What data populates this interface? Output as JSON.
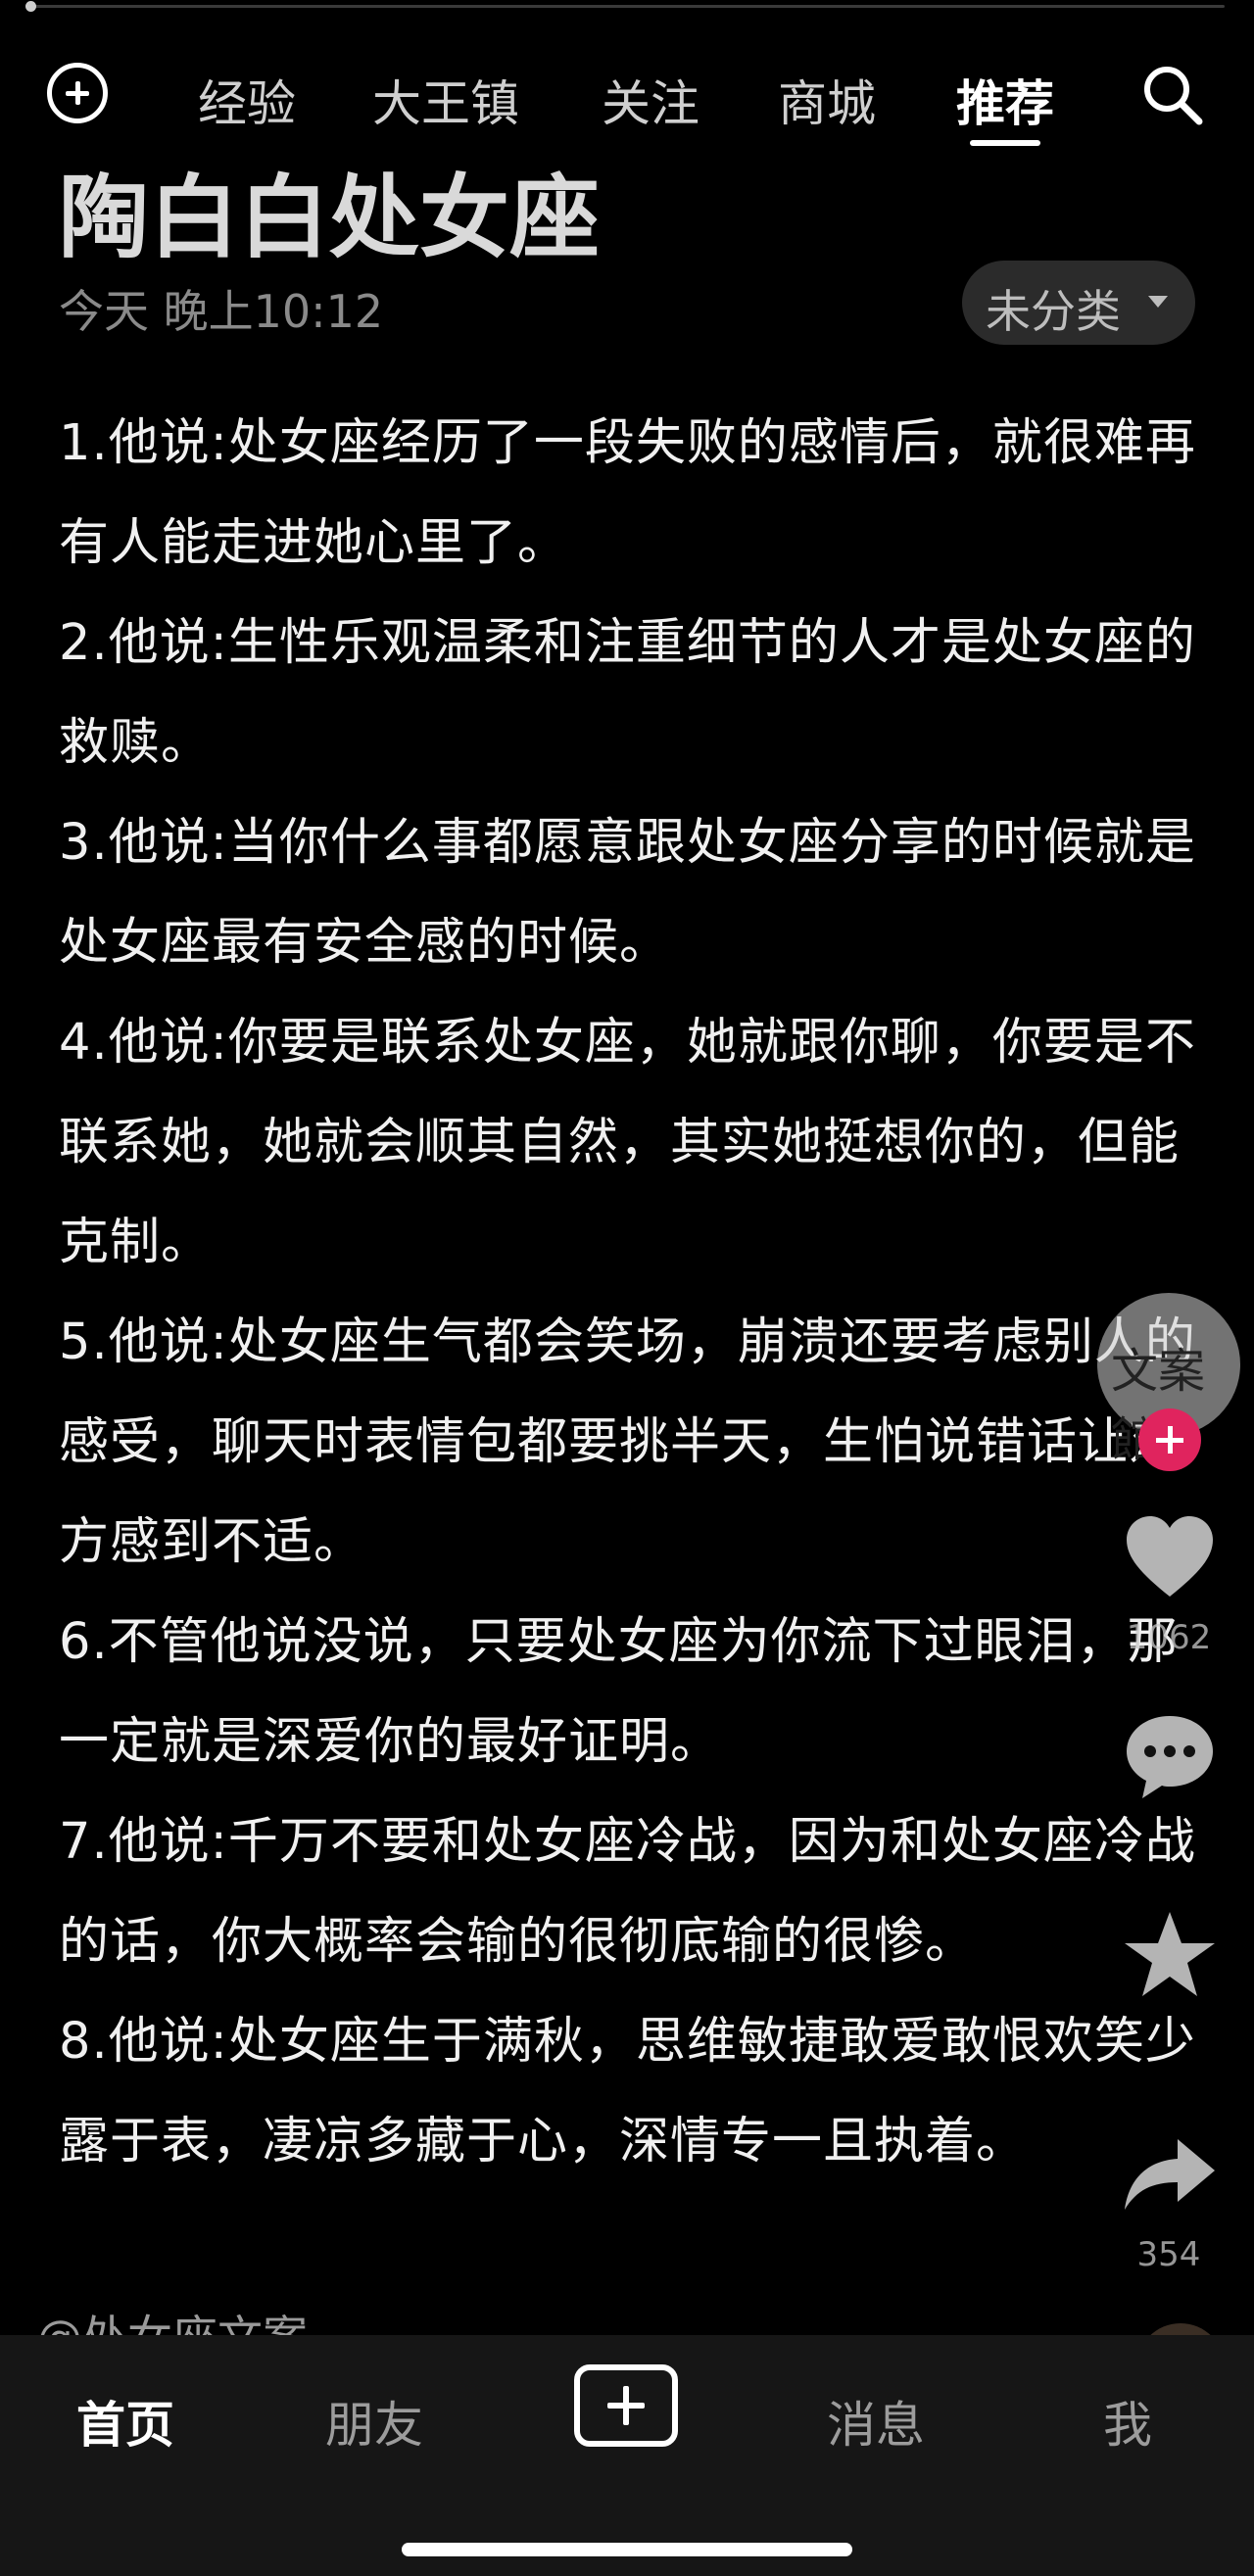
{
  "top_nav": {
    "tabs": [
      {
        "label": "经验",
        "active": false
      },
      {
        "label": "大王镇",
        "active": false
      },
      {
        "label": "关注",
        "active": false
      },
      {
        "label": "商城",
        "active": false
      },
      {
        "label": "推荐",
        "active": true
      }
    ]
  },
  "post": {
    "title": "陶白白处女座",
    "time": "今天 晚上10:12",
    "category": "未分类",
    "paragraphs": [
      "1.他说:处女座经历了一段失败的感情后，就很难再有人能走进她心里了。",
      "2.他说:生性乐观温柔和注重细节的人才是处女座的救赎。",
      "3.他说:当你什么事都愿意跟处女座分享的时候就是处女座最有安全感的时候。",
      "4.他说:你要是联系处女座，她就跟你聊，你要是不联系她，她就会顺其自然，其实她挺想你的，但能克制。",
      "5.他说:处女座生气都会笑场，崩溃还要考虑别人的感受，聊天时表情包都要挑半天，生怕说错话让对方感到不适。",
      "6.不管他说没说，只要处女座为你流下过眼泪，那一定就是深爱你的最好证明。",
      "7.他说:千万不要和处女座冷战，因为和处女座冷战的话，你大概率会输的很彻底输的很惨。",
      "8.他说:处女座生于满秋，思维敏捷敢爱敢恨欢笑少露于表，凄凉多藏于心，深情专一且执着。"
    ],
    "author": "@处女座文案"
  },
  "rail": {
    "avatar_text": "文案館",
    "like_count": "1062",
    "share_count": "354"
  },
  "bottom_nav": {
    "home": "首页",
    "friends": "朋友",
    "messages": "消息",
    "me": "我"
  },
  "colors": {
    "background": "#000000",
    "follow_badge": "#e0245e",
    "bottom_bar": "#161616"
  }
}
